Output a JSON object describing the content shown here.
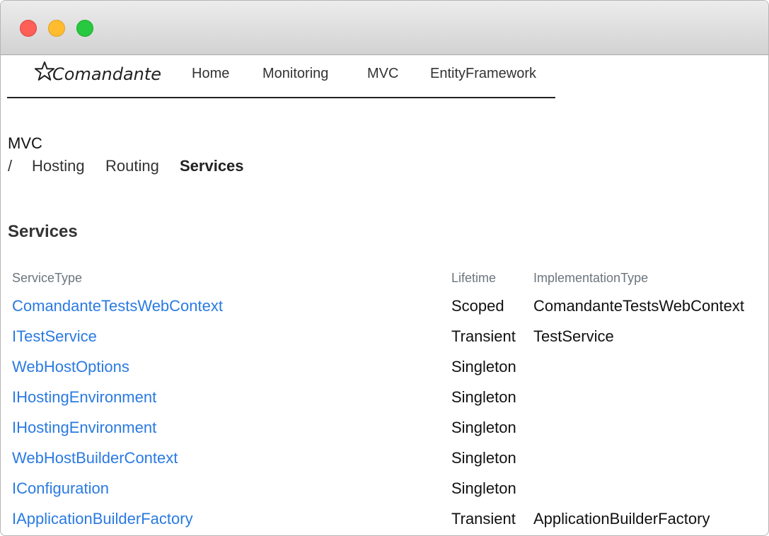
{
  "brand": {
    "name": "Comandante",
    "icon": "star-outline-icon"
  },
  "nav": {
    "items": [
      "Home",
      "Monitoring",
      "MVC",
      "EntityFramework"
    ]
  },
  "breadcrumb": {
    "title": "MVC",
    "separator": "/"
  },
  "subnav": {
    "items": [
      "Hosting",
      "Routing",
      "Services"
    ],
    "active": "Services"
  },
  "section": {
    "title": "Services"
  },
  "table": {
    "headers": [
      "ServiceType",
      "Lifetime",
      "ImplementationType"
    ],
    "rows": [
      {
        "service_type": "ComandanteTestsWebContext",
        "lifetime": "Scoped",
        "implementation_type": "ComandanteTestsWebContext"
      },
      {
        "service_type": "ITestService",
        "lifetime": "Transient",
        "implementation_type": "TestService"
      },
      {
        "service_type": "WebHostOptions",
        "lifetime": "Singleton",
        "implementation_type": ""
      },
      {
        "service_type": "IHostingEnvironment",
        "lifetime": "Singleton",
        "implementation_type": ""
      },
      {
        "service_type": "IHostingEnvironment",
        "lifetime": "Singleton",
        "implementation_type": ""
      },
      {
        "service_type": "WebHostBuilderContext",
        "lifetime": "Singleton",
        "implementation_type": ""
      },
      {
        "service_type": "IConfiguration",
        "lifetime": "Singleton",
        "implementation_type": ""
      },
      {
        "service_type": "IApplicationBuilderFactory",
        "lifetime": "Transient",
        "implementation_type": "ApplicationBuilderFactory"
      }
    ]
  },
  "colors": {
    "link": "#2a7ae2",
    "header_text": "#6c757d",
    "nav_border": "#222222"
  }
}
